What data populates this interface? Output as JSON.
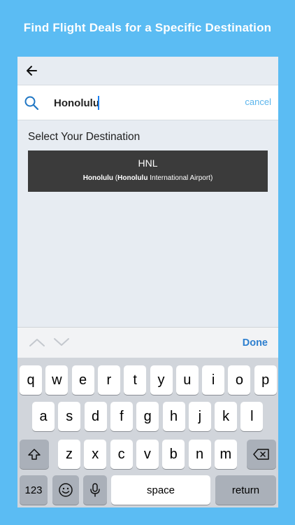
{
  "promo": {
    "headline": "Find Flight Deals for a Specific Destination"
  },
  "nav": {
    "back_icon": "arrow-left-icon"
  },
  "search": {
    "icon": "search-icon",
    "value": "Honolulu",
    "cancel_label": "cancel"
  },
  "section": {
    "title": "Select Your Destination"
  },
  "results": [
    {
      "code": "HNL",
      "city": "Honolulu",
      "airport_match": "Honolulu",
      "airport_rest": " International Airport",
      "open_paren": " (",
      "close_paren": ")"
    }
  ],
  "accessory": {
    "done_label": "Done",
    "prev_icon": "chevron-up-icon",
    "next_icon": "chevron-down-icon"
  },
  "keyboard": {
    "row1": [
      "q",
      "w",
      "e",
      "r",
      "t",
      "y",
      "u",
      "i",
      "o",
      "p"
    ],
    "row2": [
      "a",
      "s",
      "d",
      "f",
      "g",
      "h",
      "j",
      "k",
      "l"
    ],
    "row3": [
      "z",
      "x",
      "c",
      "v",
      "b",
      "n",
      "m"
    ],
    "numbers_label": "123",
    "space_label": "space",
    "return_label": "return"
  },
  "colors": {
    "background": "#5bbcf3",
    "result_bg": "#3b3b3b",
    "done": "#2d7fcf",
    "cancel": "#5bb5ec"
  }
}
